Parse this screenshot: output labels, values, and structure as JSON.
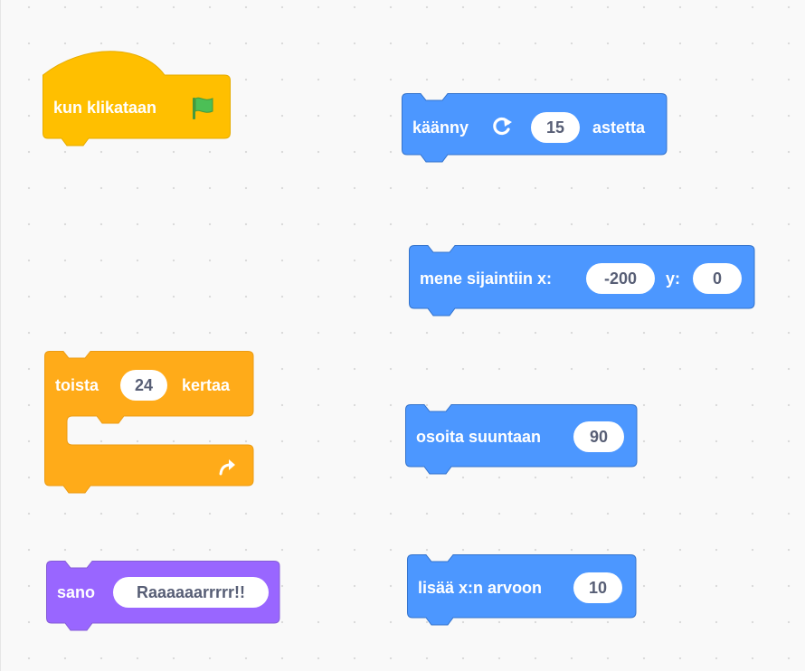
{
  "colors": {
    "events": "#ffbf00",
    "events_edge": "#e6ac00",
    "control": "#ffab19",
    "control_edge": "#ec9c13",
    "looks": "#9966ff",
    "looks_edge": "#855cd6",
    "motion": "#4c97ff",
    "motion_edge": "#3373cc",
    "input_text": "#575e75"
  },
  "blocks": {
    "when_flag_clicked": {
      "label": "kun klikataan",
      "icon": "green-flag-icon"
    },
    "repeat": {
      "label_before": "toista",
      "times": "24",
      "label_after": "kertaa",
      "end_icon": "loop-arrow-icon"
    },
    "say": {
      "label": "sano",
      "message": "Raaaaaarrrrr!!"
    },
    "turn": {
      "label_before": "käänny",
      "icon": "rotate-right-icon",
      "degrees": "15",
      "label_after": "astetta"
    },
    "goto_xy": {
      "label_before": "mene sijaintiin x:",
      "x": "-200",
      "label_mid": "y:",
      "y": "0"
    },
    "point_direction": {
      "label": "osoita suuntaan",
      "direction": "90"
    },
    "change_x": {
      "label": "lisää x:n arvoon",
      "amount": "10"
    }
  }
}
